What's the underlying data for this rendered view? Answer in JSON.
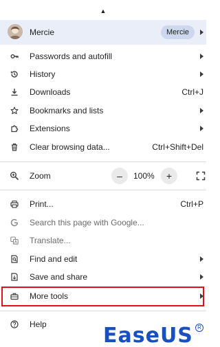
{
  "profile": {
    "name": "Mercie",
    "chip": "Mercie"
  },
  "items_a": [
    {
      "label": "Passwords and autofill",
      "shortcut": ""
    },
    {
      "label": "History",
      "shortcut": ""
    },
    {
      "label": "Downloads",
      "shortcut": "Ctrl+J"
    },
    {
      "label": "Bookmarks and lists",
      "shortcut": ""
    },
    {
      "label": "Extensions",
      "shortcut": ""
    },
    {
      "label": "Clear browsing data...",
      "shortcut": "Ctrl+Shift+Del"
    }
  ],
  "zoom": {
    "label": "Zoom",
    "minus": "–",
    "value": "100%",
    "plus": "+"
  },
  "items_b": [
    {
      "label": "Print...",
      "shortcut": "Ctrl+P"
    },
    {
      "label": "Search this page with Google...",
      "shortcut": ""
    },
    {
      "label": "Translate...",
      "shortcut": ""
    },
    {
      "label": "Find and edit",
      "shortcut": ""
    },
    {
      "label": "Save and share",
      "shortcut": ""
    },
    {
      "label": "More tools",
      "shortcut": ""
    }
  ],
  "help": {
    "label": "Help"
  },
  "watermark": {
    "text": "EaseUS",
    "registered": "R"
  },
  "colors": {
    "highlight_border": "#e0101a",
    "profile_bg": "#e9eef9",
    "logo": "#1a4fbf"
  }
}
